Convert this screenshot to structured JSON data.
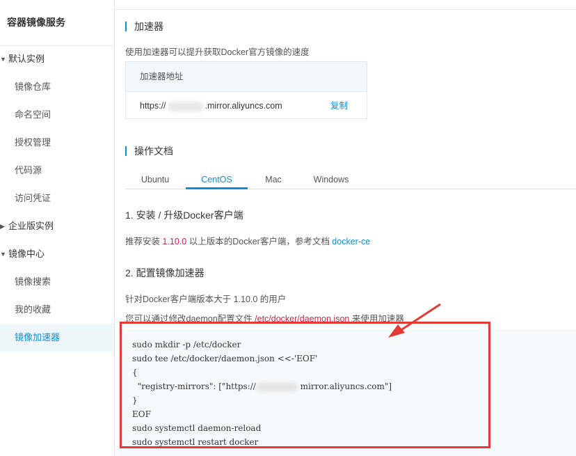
{
  "sidebar": {
    "title": "容器镜像服务",
    "items": [
      {
        "label": "默认实例",
        "type": "group",
        "expanded": true
      },
      {
        "label": "镜像仓库",
        "type": "child"
      },
      {
        "label": "命名空间",
        "type": "child"
      },
      {
        "label": "授权管理",
        "type": "child"
      },
      {
        "label": "代码源",
        "type": "child"
      },
      {
        "label": "访问凭证",
        "type": "child"
      },
      {
        "label": "企业版实例",
        "type": "group",
        "expanded": false
      },
      {
        "label": "镜像中心",
        "type": "group",
        "expanded": true
      },
      {
        "label": "镜像搜索",
        "type": "child"
      },
      {
        "label": "我的收藏",
        "type": "child"
      },
      {
        "label": "镜像加速器",
        "type": "child",
        "active": true
      }
    ]
  },
  "accelerator": {
    "title": "加速器",
    "desc": "使用加速器可以提升获取Docker官方镜像的速度",
    "box_header": "加速器地址",
    "url_prefix": "https://",
    "url_suffix": ".mirror.aliyuncs.com",
    "copy_label": "复制"
  },
  "docs": {
    "title": "操作文档",
    "tabs": [
      "Ubuntu",
      "CentOS",
      "Mac",
      "Windows"
    ],
    "active_tab": "CentOS",
    "step1": {
      "title": "1. 安装 / 升级Docker客户端",
      "text_before": "推荐安装 ",
      "version": "1.10.0",
      "text_middle": " 以上版本的Docker客户端，参考文档 ",
      "link": "docker-ce"
    },
    "step2": {
      "title": "2. 配置镜像加速器",
      "line1": "针对Docker客户端版本大于 1.10.0 的用户",
      "line2_before": "您可以通过修改daemon配置文件 ",
      "line2_path": "/etc/docker/daemon.json",
      "line2_after": " 来使用加速器"
    },
    "code": {
      "line1": "sudo mkdir -p /etc/docker",
      "line2": "sudo tee /etc/docker/daemon.json <<-'EOF'",
      "line3": "{",
      "line4_before": "  \"registry-mirrors\": [\"https://",
      "line4_after": " mirror.aliyuncs.com\"]",
      "line5": "}",
      "line6": "EOF",
      "line7": "sudo systemctl daemon-reload",
      "line8": "sudo systemctl restart docker"
    }
  },
  "colors": {
    "accent": "#0a8fd1",
    "highlight_red": "#c7254e",
    "annotation_red": "#e53935"
  }
}
